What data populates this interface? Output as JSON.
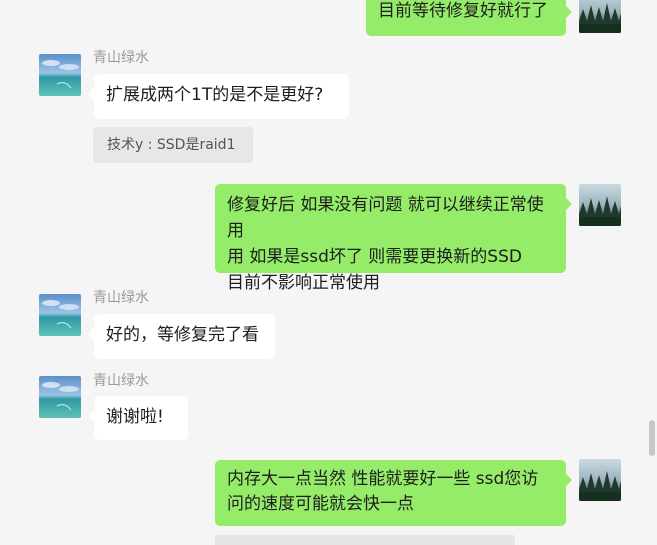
{
  "contact_name": "青山绿水",
  "messages": [
    {
      "side": "right",
      "text": "目前等待修复好就行了"
    },
    {
      "side": "left",
      "sender": "青山绿水",
      "text": "扩展成两个1T的是不是更好?"
    },
    {
      "side": "left",
      "type": "quote",
      "text": "技术y : SSD是raid1"
    },
    {
      "side": "right",
      "text": "修复好后 如果没有问题 就可以继续正常使用\n用  如果是ssd坏了 则需要更换新的SSD\n目前不影响正常使用"
    },
    {
      "side": "left",
      "sender": "青山绿水",
      "text": "好的，等修复完了看"
    },
    {
      "side": "left",
      "sender": "青山绿水",
      "text": "谢谢啦!"
    },
    {
      "side": "right",
      "text": "内存大一点当然 性能就要好一些  ssd您访\n问的速度可能就会快一点"
    }
  ],
  "colors": {
    "background": "#f5f5f5",
    "self_bubble": "#95ec69",
    "other_bubble": "#ffffff",
    "quote_bg": "#e7e7e7",
    "name_text": "#9a9a9a"
  },
  "icons": {
    "self_avatar": "forest-avatar-icon",
    "contact_avatar": "sea-avatar-icon"
  }
}
